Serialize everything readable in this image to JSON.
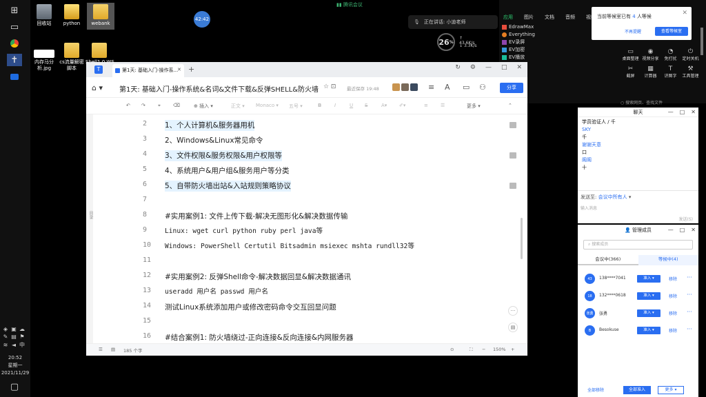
{
  "taskbar": {
    "clock_time": "20:52",
    "clock_day": "星期一",
    "clock_date": "2021/11/29"
  },
  "desktop": {
    "icons": [
      {
        "label": "回收站"
      },
      {
        "label": "python"
      },
      {
        "label": "webank"
      },
      {
        "label": "内存马分析.jpg"
      },
      {
        "label": "cs流量解密脚本"
      },
      {
        "label": "Shell1.0.WS"
      }
    ]
  },
  "meeting": {
    "title": "腾讯会议",
    "timer": "42:42",
    "speaking": "正在讲话: 小迪老师",
    "net_score": "26",
    "net_unit": "%",
    "net_up": "43.6K/s",
    "net_down": "3.3K/s"
  },
  "search_panel": {
    "tabs": [
      "应用",
      "图片",
      "文档",
      "音频",
      "视频"
    ],
    "active_tab": "应用",
    "apps": [
      "EdrawMax",
      "Everything",
      "EV录屏",
      "EV加密",
      "EV播放"
    ],
    "tools": [
      {
        "label": "桌面整理",
        "icon": "desktop-icon"
      },
      {
        "label": "视频分享",
        "icon": "eye-icon"
      },
      {
        "label": "免打扰",
        "icon": "bell-icon"
      },
      {
        "label": "定时关机",
        "icon": "power-icon"
      },
      {
        "label": "截屏",
        "icon": "scissor-icon"
      },
      {
        "label": "计算器",
        "icon": "calc-icon"
      },
      {
        "label": "识图字",
        "icon": "text-icon"
      },
      {
        "label": "工具管理",
        "icon": "tool-icon"
      }
    ],
    "search_hint": "○ 搜索网页、查找文件"
  },
  "notice": {
    "text_prefix": "当前等候室已有",
    "count": "4",
    "text_suffix": "人等候",
    "btn_no": "不再提醒",
    "btn_yes": "查看等候室"
  },
  "chat": {
    "title": "聊天",
    "messages": [
      {
        "name": "",
        "text": "学员验证人 / 千"
      },
      {
        "name": "SKY",
        "text": "千"
      },
      {
        "name": "谢谢天意",
        "text": "口"
      },
      {
        "name": "阁阁",
        "text": "十"
      }
    ],
    "to_label": "发送至:",
    "to_value": "会议中所有人",
    "input_placeholder": "输入消息",
    "send": "发送(S)"
  },
  "members": {
    "title": "管理成员",
    "search_placeholder": "搜索成员",
    "tab_in": "会议中(366)",
    "tab_wait": "等候中(4)",
    "rows": [
      {
        "avatar": "43",
        "name": "138****7041"
      },
      {
        "avatar": "18",
        "name": "132****0618"
      },
      {
        "avatar": "张勇",
        "name": "张勇"
      },
      {
        "avatar": "B",
        "name": "Besokuse"
      }
    ],
    "admit_label": "准入 ▾",
    "remove_label": "移除",
    "more_label": "···",
    "footer_remove_all": "全部移除",
    "footer_admit_all": "全部准入",
    "footer_more": "更多 ▾"
  },
  "doc": {
    "tab_title": "第1天: 基础入门-操作系...",
    "title": "第1天: 基础入门-操作系统&名词&文件下载&反弹SHELL&防火墙...",
    "saved": "最近保存 19:48",
    "share": "分享",
    "toolbar": {
      "insert": "⊕ 插入 ▾",
      "font_style": "正文 ▾",
      "font_face": "Monaco ▾",
      "font_size": "五号 ▾",
      "more": "更多 ▾"
    },
    "side_label": "目录",
    "lines": [
      {
        "n": "2",
        "text": "1、个人计算机&服务器用机",
        "hl": true
      },
      {
        "n": "3",
        "text": "2、Windows&Linux常见命令",
        "hl": false
      },
      {
        "n": "4",
        "text": "3、文件权限&服务权限&用户权限等",
        "hl": true
      },
      {
        "n": "5",
        "text": "4、系统用户&用户组&服务用户等分类",
        "hl": false
      },
      {
        "n": "6",
        "text": "5、自带防火墙出站&入站规则策略协议",
        "hl": true
      },
      {
        "n": "7",
        "text": "",
        "hl": false
      },
      {
        "n": "8",
        "text": "#实用案例1: 文件上传下载-解决无图形化&解决数据传输",
        "hl": false
      },
      {
        "n": "9",
        "text": "Linux: wget curl python ruby perl java等",
        "hl": false
      },
      {
        "n": "10",
        "text": "Windows: PowerShell Certutil Bitsadmin msiexec mshta rundll32等",
        "hl": false
      },
      {
        "n": "11",
        "text": "",
        "hl": false
      },
      {
        "n": "12",
        "text": "#实用案例2: 反弹Shell命令-解决数据回显&解决数据通讯",
        "hl": false
      },
      {
        "n": "13",
        "text": "useradd 用户名 passwd 用户名",
        "hl": false
      },
      {
        "n": "14",
        "text": "测试Linux系统添加用户或修改密码命令交互回显问题",
        "hl": false
      },
      {
        "n": "15",
        "text": "",
        "hl": false
      },
      {
        "n": "16",
        "text": "#结合案例1: 防火墙绕过-正向连接&反向连接&内网服务器",
        "hl": false
      }
    ],
    "status_words": "185 个字",
    "status_zoom": "150%"
  }
}
